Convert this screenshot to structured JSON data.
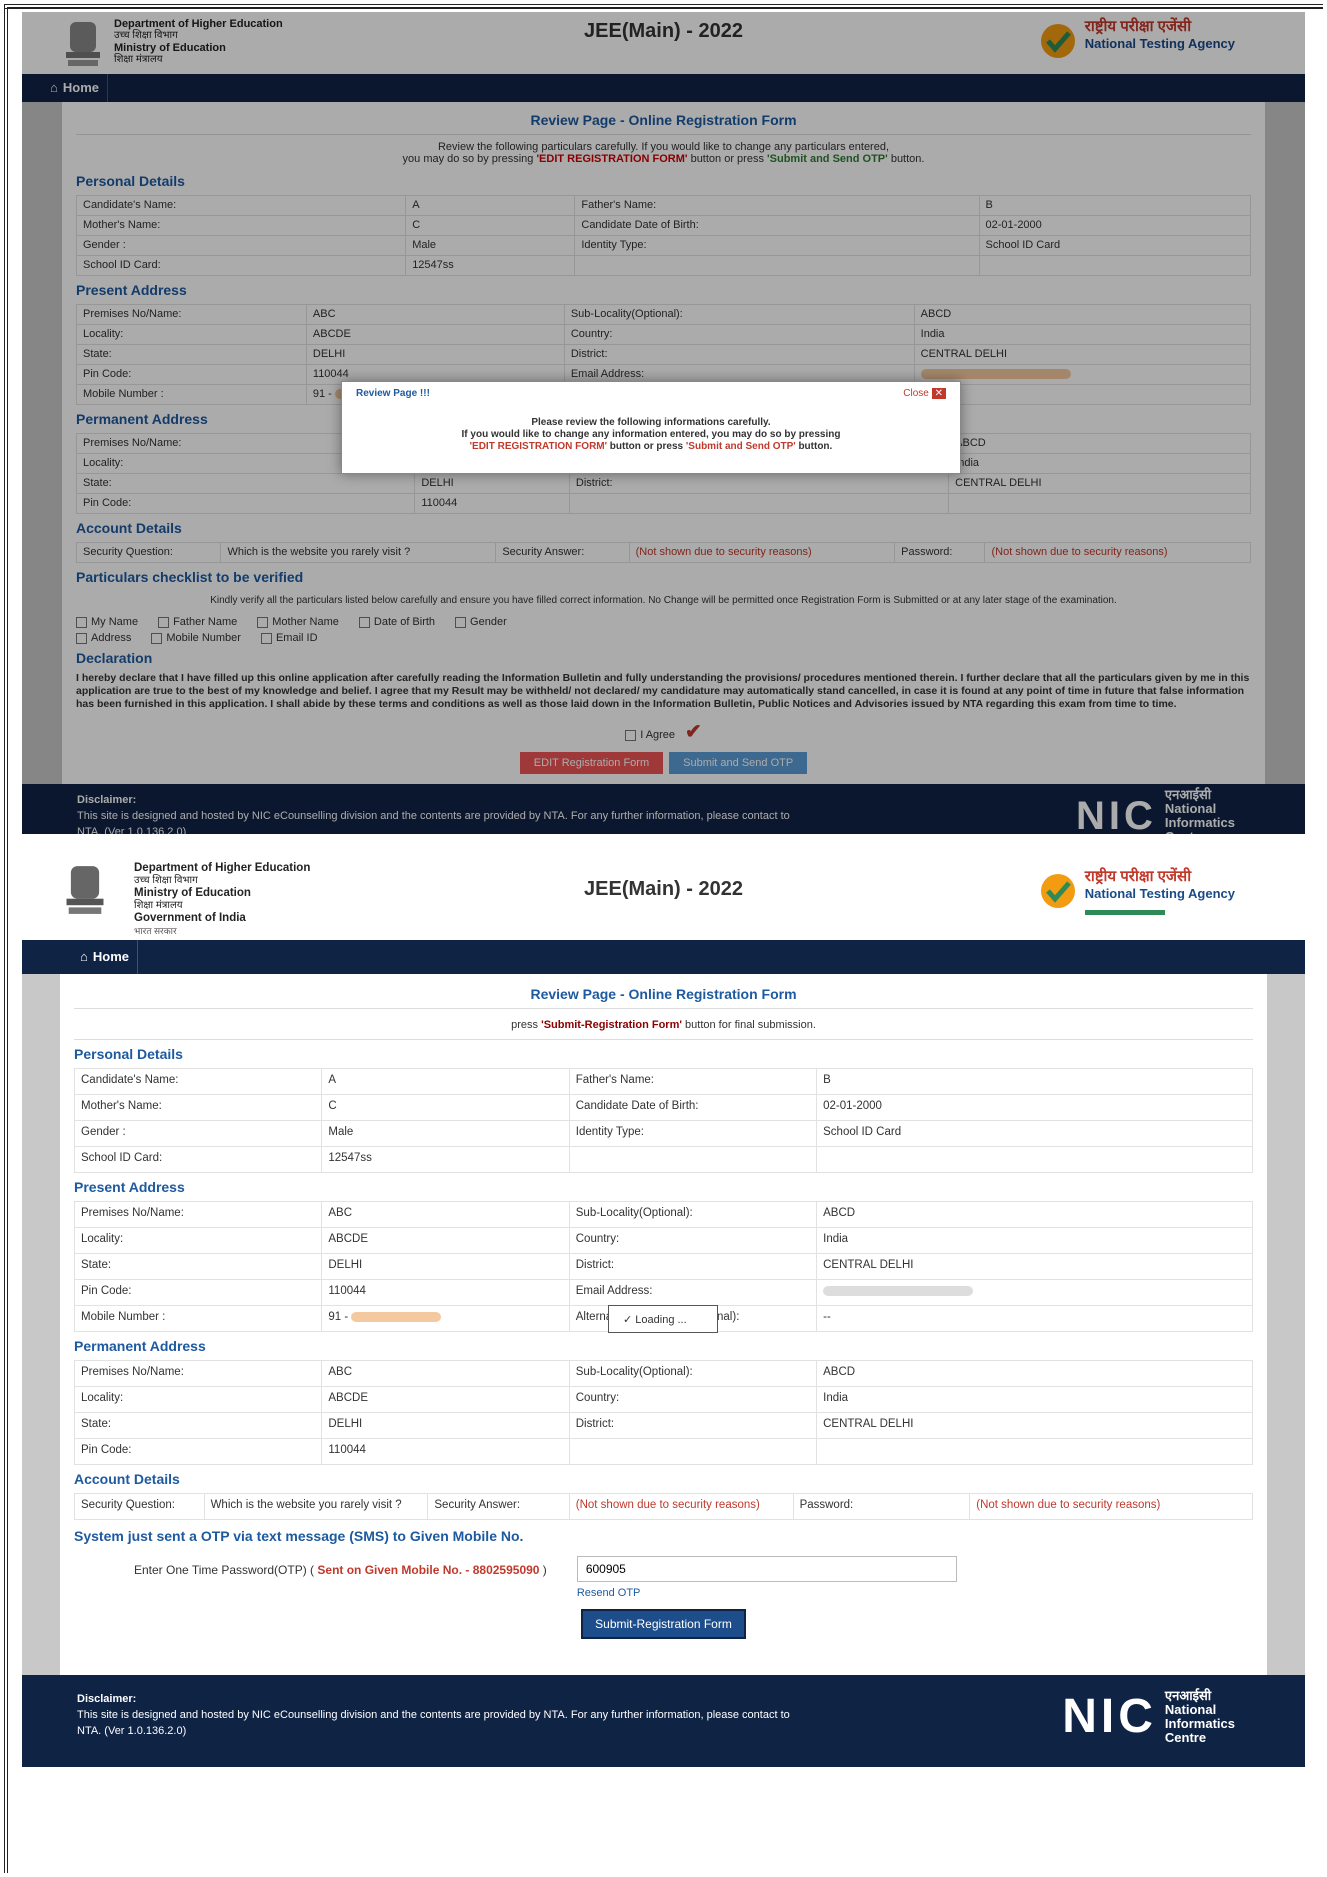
{
  "header": {
    "dept_lines": [
      "Department of Higher Education",
      "उच्च शिक्षा विभाग",
      "Ministry of Education",
      "शिक्षा मंत्रालय",
      "Government of India"
    ],
    "dept_footer": "भारत सरकार",
    "title": "JEE(Main) - 2022",
    "nta_hindi": "राष्ट्रीय परीक्षा एजेंसी",
    "nta_english": "National Testing Agency"
  },
  "nav": {
    "home_label": "Home"
  },
  "review_title": "Review Page - Online Registration Form",
  "shot1": {
    "note_line1": "Review the following particulars carefully. If you would like to change any particulars entered,",
    "note_line2_pre": "you may do so by pressing ",
    "note_line2_edit": "'EDIT REGISTRATION FORM'",
    "note_line2_mid": " button or press ",
    "note_line2_otp": "'Submit and Send OTP'",
    "note_line2_post": " button.",
    "checklist_title": "Particulars checklist to be verified",
    "checklist_note": "Kindly verify all the particulars listed below carefully and ensure you have filled correct information. No Change will be permitted once Registration Form is Submitted or at any later stage of the examination.",
    "checklist_items": [
      "My Name",
      "Father Name",
      "Mother Name",
      "Date of Birth",
      "Gender",
      "Address",
      "Mobile Number",
      "Email ID"
    ],
    "declaration_title": "Declaration",
    "declaration_text": "I hereby declare that I have filled up this online application after carefully reading the Information Bulletin and fully understanding the provisions/ procedures mentioned therein. I further declare that all the particulars given by me in this application are true to the best of my knowledge and belief. I agree that my Result may be withheld/ not declared/ my candidature may automatically stand cancelled, in case it is found at any point of time in future that false information has been furnished in this application. I shall abide by these terms and conditions as well as those laid down in the Information Bulletin, Public Notices and Advisories issued by NTA regarding this exam from time to time.",
    "agree_label": "I Agree",
    "edit_button": "EDIT Registration Form",
    "otp_button": "Submit and Send OTP",
    "modal": {
      "title": "Review Page !!!",
      "close": "Close",
      "line1": "Please review the following informations carefully.",
      "line2": "If you would like to change any information entered, you may do so by pressing",
      "line3_edit": "'EDIT REGISTRATION FORM'",
      "line3_mid": " button or press ",
      "line3_otp": "'Submit and Send OTP'",
      "line3_post": " button."
    }
  },
  "shot2": {
    "note_pre": "press ",
    "note_bold": "'Submit-Registration Form'",
    "note_post": " button for final submission.",
    "otp_section_title": "System just sent a OTP via text message (SMS) to Given Mobile No.",
    "otp_label_pre": "Enter One Time Password(OTP) ( ",
    "otp_label_red": "Sent on Given Mobile No. - 8802595090",
    "otp_label_post": " )",
    "otp_value": "600905",
    "resend_label": "Resend OTP",
    "submit_button": "Submit-Registration Form",
    "loading": "Loading ..."
  },
  "sections": {
    "personal": "Personal Details",
    "present": "Present Address",
    "permanent": "Permanent Address",
    "account": "Account Details"
  },
  "personal": {
    "r1": [
      "Candidate's Name:",
      "A",
      "Father's Name:",
      "B"
    ],
    "r2": [
      "Mother's Name:",
      "C",
      "Candidate Date of Birth:",
      "02-01-2000"
    ],
    "r3": [
      "Gender :",
      "Male",
      "Identity Type:",
      "School ID Card"
    ],
    "r4": [
      "School ID Card:",
      "12547ss",
      "",
      ""
    ]
  },
  "present": {
    "r1": [
      "Premises No/Name:",
      "ABC",
      "Sub-Locality(Optional):",
      "ABCD"
    ],
    "r2": [
      "Locality:",
      "ABCDE",
      "Country:",
      "India"
    ],
    "r3": [
      "State:",
      "DELHI",
      "District:",
      "CENTRAL DELHI"
    ],
    "r4": [
      "Pin Code:",
      "110044",
      "Email Address:",
      ""
    ],
    "r5": [
      "Mobile Number :",
      "91 - ",
      "Alternate Contact No.(Optional):",
      "--"
    ]
  },
  "permanent": {
    "r1": [
      "Premises No/Name:",
      "ABC",
      "Sub-Locality(Optional):",
      "ABCD"
    ],
    "r2": [
      "Locality:",
      "ABCDE",
      "Country:",
      "India"
    ],
    "r3": [
      "State:",
      "DELHI",
      "District:",
      "CENTRAL DELHI"
    ],
    "r4": [
      "Pin Code:",
      "110044",
      "",
      ""
    ]
  },
  "account": {
    "q_label": "Security Question:",
    "q_value": "Which is the website you rarely visit ?",
    "a_label": "Security Answer:",
    "a_value": "(Not shown due to security reasons)",
    "p_label": "Password:",
    "p_value": "(Not shown due to security reasons)"
  },
  "footer": {
    "title": "Disclaimer:",
    "text": "This site is designed and hosted by NIC eCounselling division and the contents are provided by NTA. For any further information, please contact to NTA. (Ver 1.0.136.2.0)",
    "nic_word": "NIC",
    "nic_hindi": "एनआईसी",
    "nic_lines": [
      "National",
      "Informatics",
      "Centre"
    ]
  },
  "colors": {
    "navy": "#0f2345",
    "link_blue": "#1d5aa0",
    "alert_red": "#c0392b"
  }
}
